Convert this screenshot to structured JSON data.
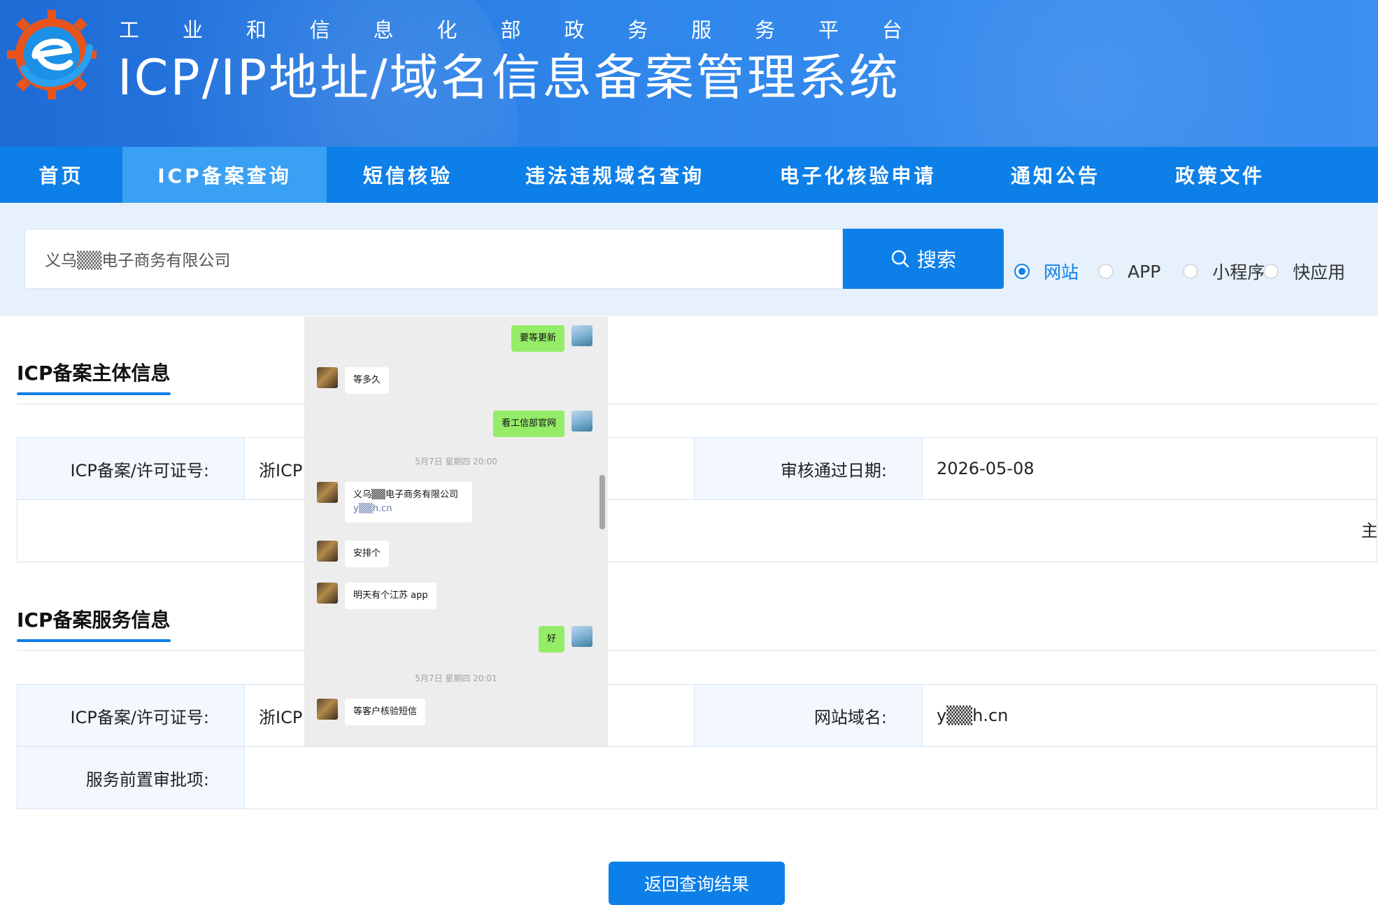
{
  "header": {
    "subtitle_chars": [
      "工",
      "业",
      "和",
      "信",
      "息",
      "化",
      "部",
      "政",
      "务",
      "服",
      "务",
      "平",
      "台"
    ],
    "title": "ICP/IP地址/域名信息备案管理系统"
  },
  "nav": {
    "items": [
      {
        "label": "首页"
      },
      {
        "label": "ICP备案查询",
        "active": true
      },
      {
        "label": "短信核验"
      },
      {
        "label": "违法违规域名查询"
      },
      {
        "label": "电子化核验申请"
      },
      {
        "label": "通知公告"
      },
      {
        "label": "政策文件"
      }
    ]
  },
  "search": {
    "value": "义乌▒▒电子商务有限公司",
    "button_label": "搜索",
    "types": [
      {
        "label": "网站",
        "checked": true
      },
      {
        "label": "APP",
        "checked": false
      },
      {
        "label": "小程序",
        "checked": false
      },
      {
        "label": "快应用",
        "checked": false
      }
    ]
  },
  "subject_info": {
    "title": "ICP备案主体信息",
    "license_label": "ICP备案/许可证号:",
    "license_value": "浙ICP",
    "approval_date_label": "审核通过日期:",
    "approval_date_value": "2026-05-08",
    "edge_char": "主"
  },
  "service_info": {
    "title": "ICP备案服务信息",
    "license_label": "ICP备案/许可证号:",
    "license_value": "浙ICP",
    "domain_label": "网站域名:",
    "domain_value": "y▒▒h.cn",
    "preapproval_label": "服务前置审批项:",
    "preapproval_value": ""
  },
  "back_button": "返回查询结果",
  "chat": {
    "messages": [
      {
        "from": "me",
        "text": "要等更新"
      },
      {
        "from": "friend",
        "text": "等多久"
      },
      {
        "from": "me",
        "text": "看工信部官网"
      },
      {
        "timestamp": "5月7日 星期四 20:00"
      },
      {
        "from": "friend",
        "text": "义乌▒▒电子商务有限公司",
        "link": "y▒▒h.cn"
      },
      {
        "from": "friend",
        "text": "安排个"
      },
      {
        "from": "friend",
        "text": "明天有个江苏 app"
      },
      {
        "from": "me",
        "text": "好"
      },
      {
        "timestamp": "5月7日 星期四 20:01"
      },
      {
        "from": "friend",
        "text": "等客户核验短信"
      }
    ]
  },
  "colors": {
    "brand_blue": "#0d7fe9",
    "nav_active": "#3aa0f3",
    "search_band": "#e6f1fc",
    "chat_green": "#95ec69"
  }
}
